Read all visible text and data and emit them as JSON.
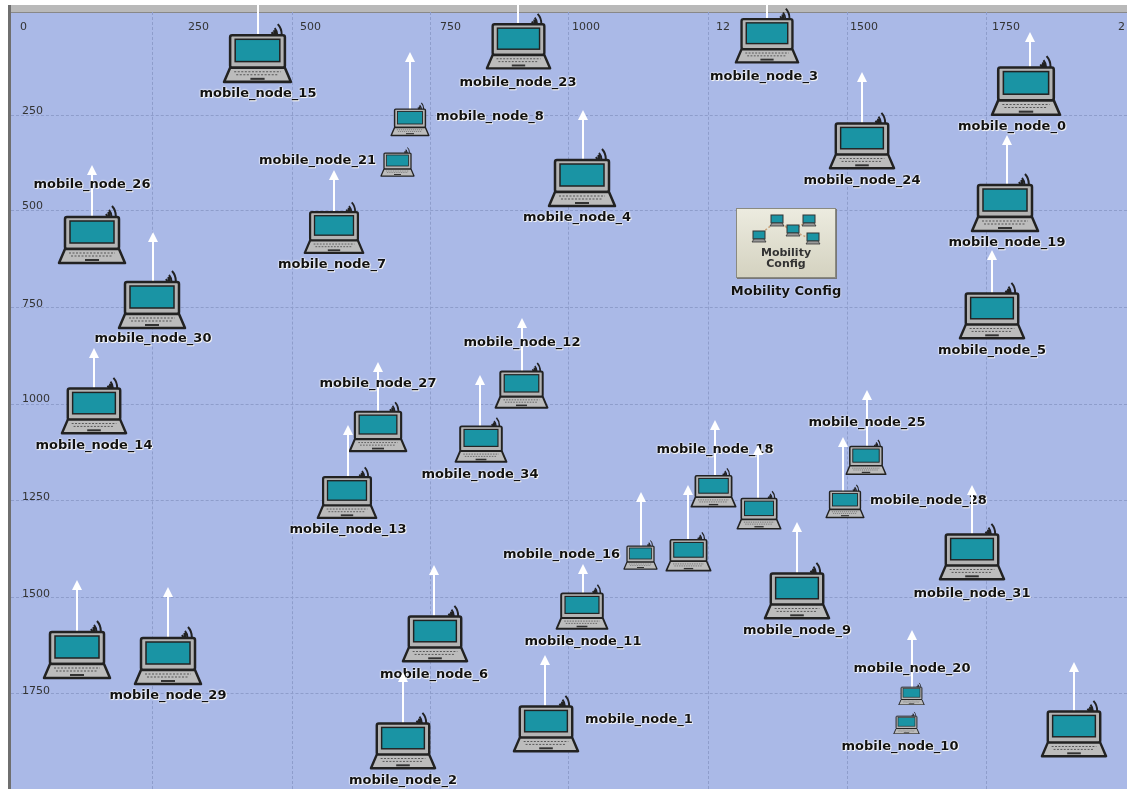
{
  "x_ruler": [
    "0",
    "250",
    "500",
    "750",
    "1000",
    "12",
    "1500",
    "1750",
    "2"
  ],
  "y_ruler": [
    "250",
    "500",
    "750",
    "1000",
    "1250",
    "1500",
    "1750"
  ],
  "nodes": [
    {
      "kind": "laptop",
      "label": "mobile_node_15"
    },
    {
      "kind": "laptop",
      "label": "mobile_node_23"
    },
    {
      "kind": "laptop",
      "label": "mobile_node_3"
    },
    {
      "kind": "laptop",
      "label": "mobile_node_0"
    },
    {
      "kind": "laptop",
      "label": "mobile_node_8"
    },
    {
      "kind": "laptop",
      "label": "mobile_node_21"
    },
    {
      "kind": "laptop",
      "label": "mobile_node_4"
    },
    {
      "kind": "laptop",
      "label": "mobile_node_24"
    },
    {
      "kind": "laptop",
      "label": "mobile_node_19"
    },
    {
      "kind": "laptop",
      "label": "mobile_node_26"
    },
    {
      "kind": "laptop",
      "label": "mobile_node_7"
    },
    {
      "kind": "laptop",
      "label": "mobile_node_30"
    },
    {
      "kind": "laptop",
      "label": "mobile_node_5"
    },
    {
      "kind": "laptop",
      "label": "mobile_node_12"
    },
    {
      "kind": "laptop",
      "label": "mobile_node_14"
    },
    {
      "kind": "laptop",
      "label": "mobile_node_27"
    },
    {
      "kind": "laptop",
      "label": "mobile_node_34"
    },
    {
      "kind": "laptop",
      "label": "mobile_node_13"
    },
    {
      "kind": "laptop",
      "label": "mobile_node_18"
    },
    {
      "kind": "laptop"
    },
    {
      "kind": "laptop",
      "label": "mobile_node_25"
    },
    {
      "kind": "laptop",
      "label": "mobile_node_28"
    },
    {
      "kind": "laptop",
      "label": "mobile_node_16"
    },
    {
      "kind": "laptop"
    },
    {
      "kind": "laptop",
      "label": "mobile_node_31"
    },
    {
      "kind": "laptop",
      "label": "mobile_node_9"
    },
    {
      "kind": "laptop",
      "label": "mobile_node_11"
    },
    {
      "kind": "laptop",
      "label": "mobile_node_6"
    },
    {
      "kind": "laptop"
    },
    {
      "kind": "laptop",
      "label": "mobile_node_29"
    },
    {
      "kind": "laptop",
      "label": "mobile_node_20"
    },
    {
      "kind": "laptop",
      "label": "mobile_node_10"
    },
    {
      "kind": "laptop",
      "label": "mobile_node_1"
    },
    {
      "kind": "laptop",
      "label": "mobile_node_2"
    },
    {
      "kind": "laptop"
    }
  ],
  "mobility_config": {
    "icon_text": "Mobility Config",
    "label": "Mobility Config"
  }
}
